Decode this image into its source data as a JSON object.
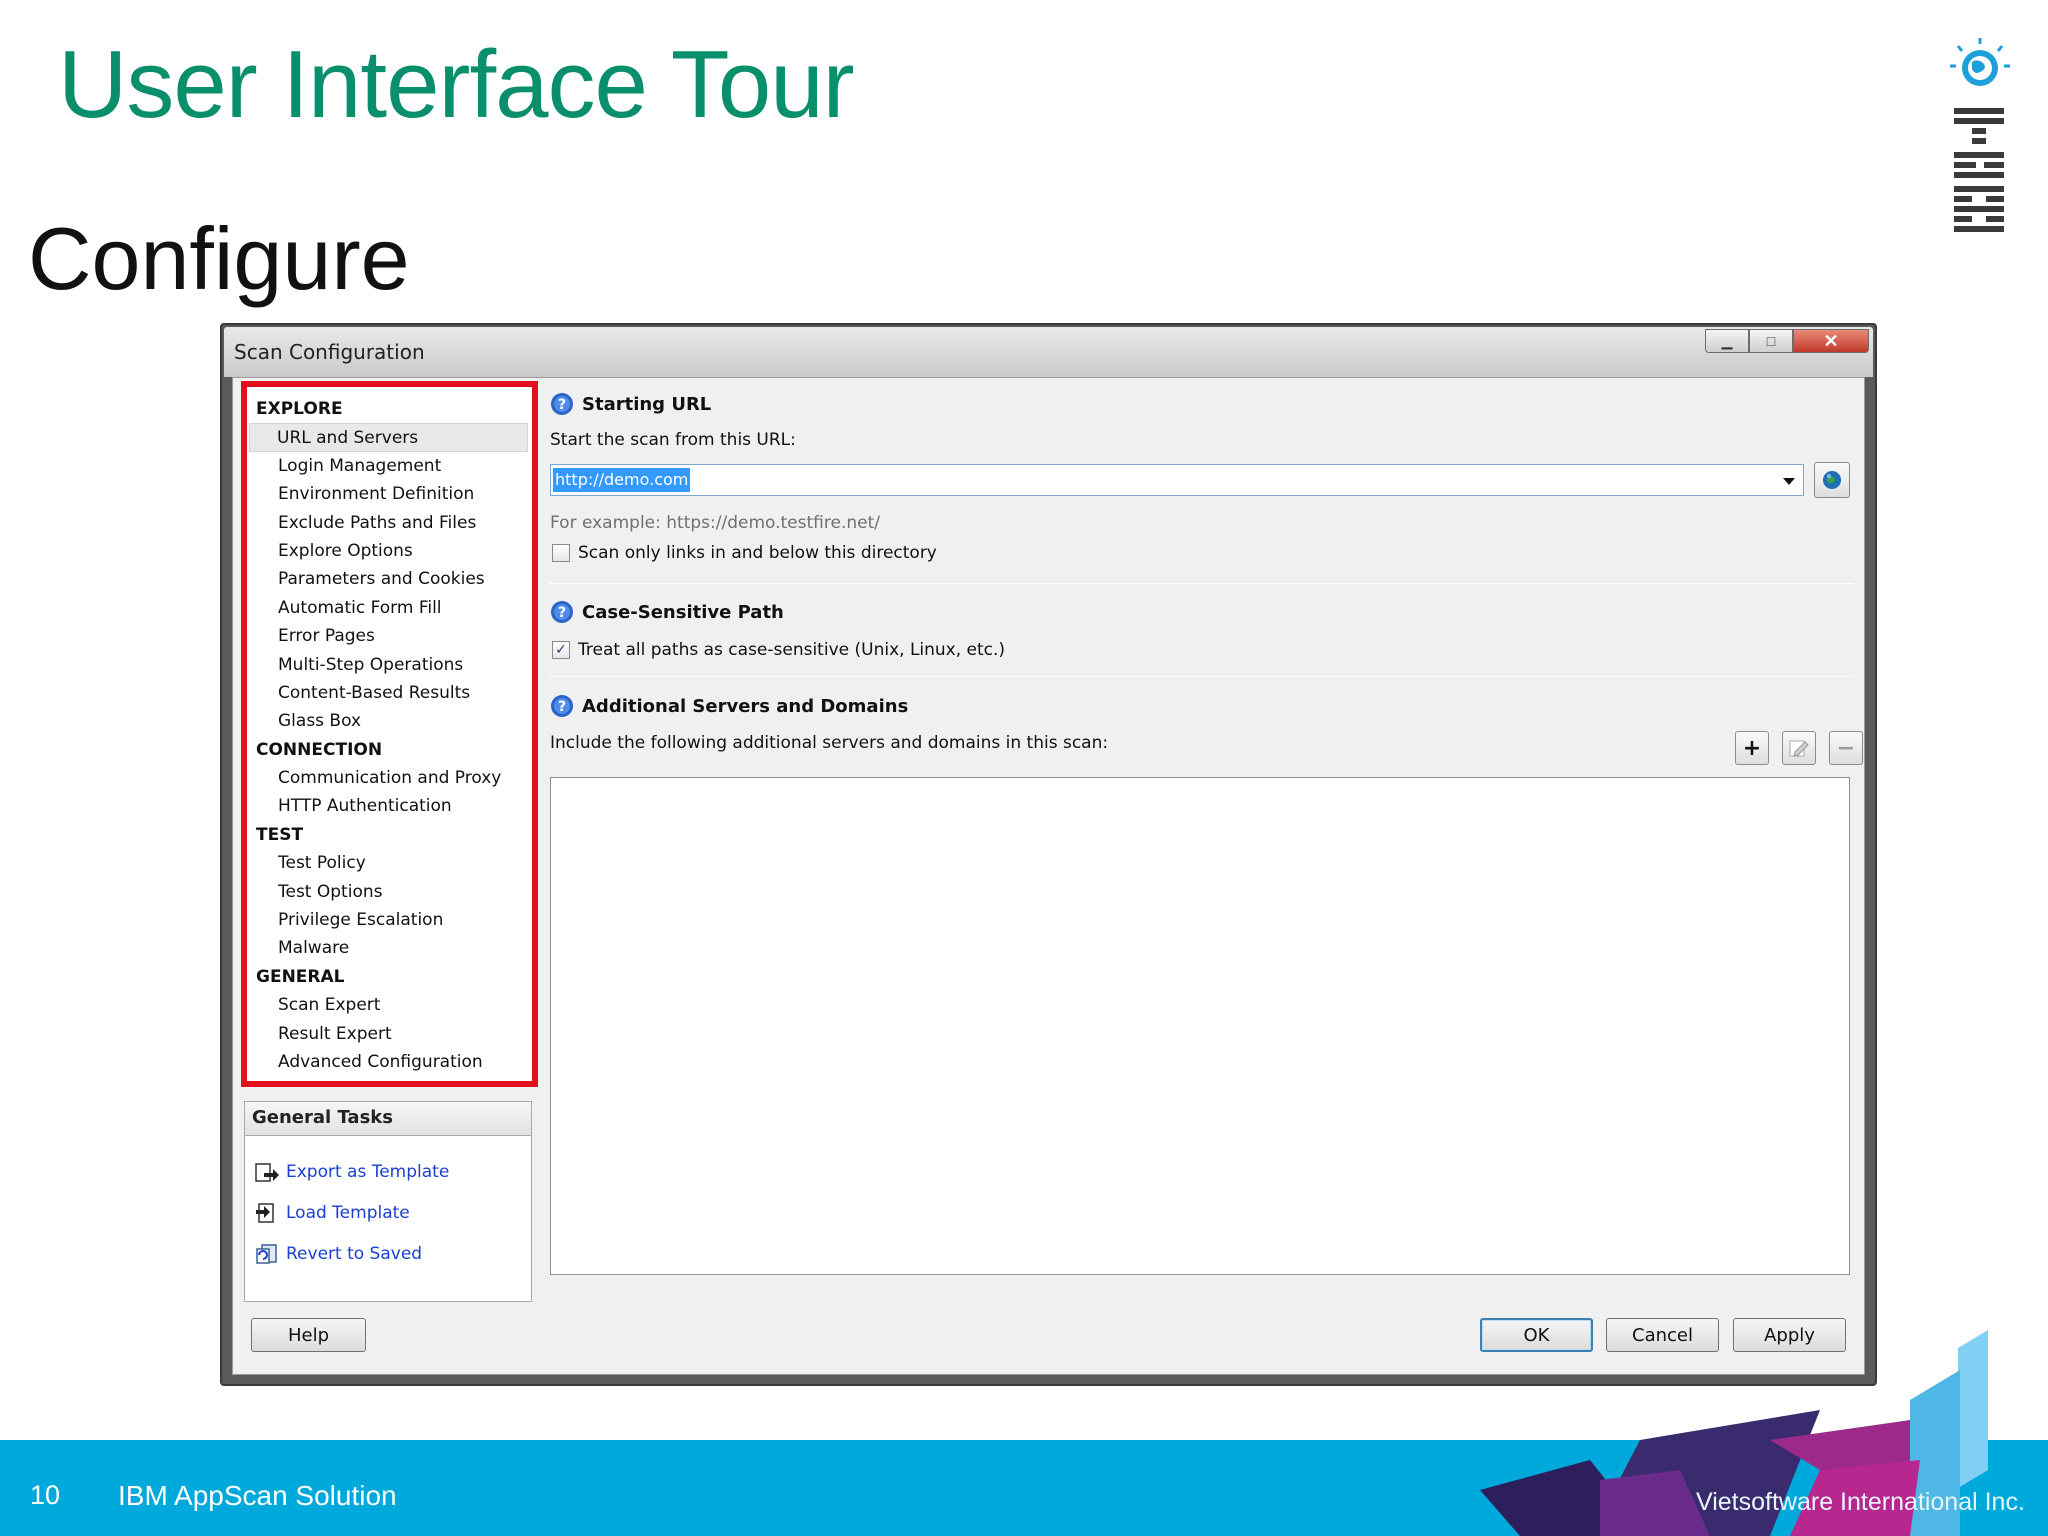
{
  "slide": {
    "title": "User Interface Tour",
    "subtitle": "Configure",
    "page_number": "10",
    "footer_title": "IBM AppScan Solution",
    "footer_company": "Vietsoftware International Inc.",
    "logo_text": "IBM"
  },
  "colors": {
    "title": "#0a8f6c",
    "footer": "#00a9dc",
    "highlight_box": "#e3101f",
    "link": "#1a3fd1"
  },
  "dialog": {
    "title": "Scan Configuration",
    "window_buttons": {
      "minimize": "▁",
      "maximize": "□",
      "close": "✕"
    },
    "nav": {
      "categories": [
        {
          "label": "EXPLORE",
          "items": [
            "URL and Servers",
            "Login Management",
            "Environment Definition",
            "Exclude Paths and Files",
            "Explore Options",
            "Parameters and Cookies",
            "Automatic Form Fill",
            "Error Pages",
            "Multi-Step Operations",
            "Content-Based Results",
            "Glass Box"
          ]
        },
        {
          "label": "CONNECTION",
          "items": [
            "Communication and Proxy",
            "HTTP Authentication"
          ]
        },
        {
          "label": "TEST",
          "items": [
            "Test Policy",
            "Test Options",
            "Privilege Escalation",
            "Malware"
          ]
        },
        {
          "label": "GENERAL",
          "items": [
            "Scan Expert",
            "Result Expert",
            "Advanced Configuration"
          ]
        }
      ],
      "selected": "URL and Servers"
    },
    "general_tasks": {
      "header": "General Tasks",
      "items": [
        {
          "label": "Export as Template",
          "icon": "export-template-icon"
        },
        {
          "label": "Load Template",
          "icon": "load-template-icon"
        },
        {
          "label": "Revert to Saved",
          "icon": "revert-icon"
        }
      ]
    },
    "starting_url": {
      "header": "Starting URL",
      "prompt": "Start the scan from this URL:",
      "value": "http://demo.com",
      "example": "For example: https://demo.testfire.net/",
      "checkbox_label": "Scan only links in and below this directory",
      "checkbox_checked": false
    },
    "case_sensitive": {
      "header": "Case-Sensitive Path",
      "checkbox_label": "Treat all paths as case-sensitive (Unix, Linux, etc.)",
      "checkbox_checked": true
    },
    "additional_servers": {
      "header": "Additional Servers and Domains",
      "prompt": "Include the following additional servers and domains in this scan:",
      "add": "+",
      "remove": "−"
    },
    "buttons": {
      "help": "Help",
      "ok": "OK",
      "cancel": "Cancel",
      "apply": "Apply"
    }
  }
}
